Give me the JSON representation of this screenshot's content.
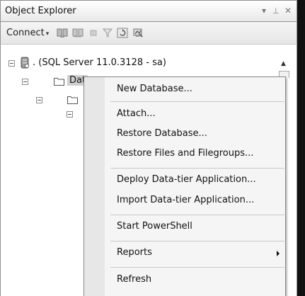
{
  "window": {
    "title": "Object Explorer",
    "controls": {
      "dropdown": "▾",
      "pin": "⊥",
      "close": "✕"
    }
  },
  "toolbar": {
    "connect_label": "Connect",
    "connect_caret": "▾",
    "icons": [
      "connect-server-icon",
      "disconnect-server-icon",
      "stop-icon",
      "filter-icon",
      "refresh-icon",
      "activity-monitor-icon"
    ]
  },
  "tree": {
    "server_label": ". (SQL Server 11.0.3128 - sa)",
    "databases_label": "Dat"
  },
  "context_menu": {
    "items": [
      "New Database...",
      "Attach...",
      "Restore Database...",
      "Restore Files and Filegroups...",
      "Deploy Data-tier Application...",
      "Import Data-tier Application...",
      "Start PowerShell",
      "Reports",
      "Refresh"
    ]
  },
  "colors": {
    "menu_background": "#f5f5f5",
    "menu_gutter": "#e7e7e7",
    "selection_highlight": "#cfcfcf"
  }
}
